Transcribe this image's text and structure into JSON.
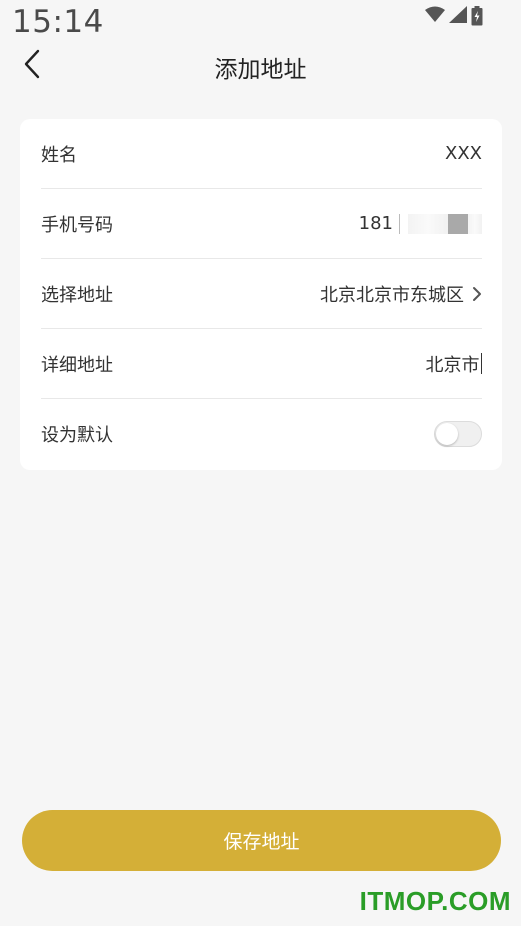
{
  "status": {
    "time": "15:14",
    "icons": [
      "wifi-icon",
      "signal-icon",
      "battery-icon"
    ]
  },
  "header": {
    "back_icon": "chevron-left-icon",
    "title": "添加地址"
  },
  "form": {
    "name": {
      "label": "姓名",
      "value": "XXX"
    },
    "phone": {
      "label": "手机号码",
      "value": "181"
    },
    "address": {
      "label": "选择地址",
      "value": "北京北京市东城区",
      "icon": "chevron-right-icon"
    },
    "detail": {
      "label": "详细地址",
      "value": "北京市"
    },
    "default": {
      "label": "设为默认",
      "enabled": false
    }
  },
  "actions": {
    "save_label": "保存地址",
    "save_color": "#d4af37"
  },
  "watermark": "ITMOP.COM",
  "colors": {
    "background": "#f6f6f6",
    "card": "#ffffff",
    "accent": "#d4af37",
    "watermark": "#2a9d27"
  }
}
